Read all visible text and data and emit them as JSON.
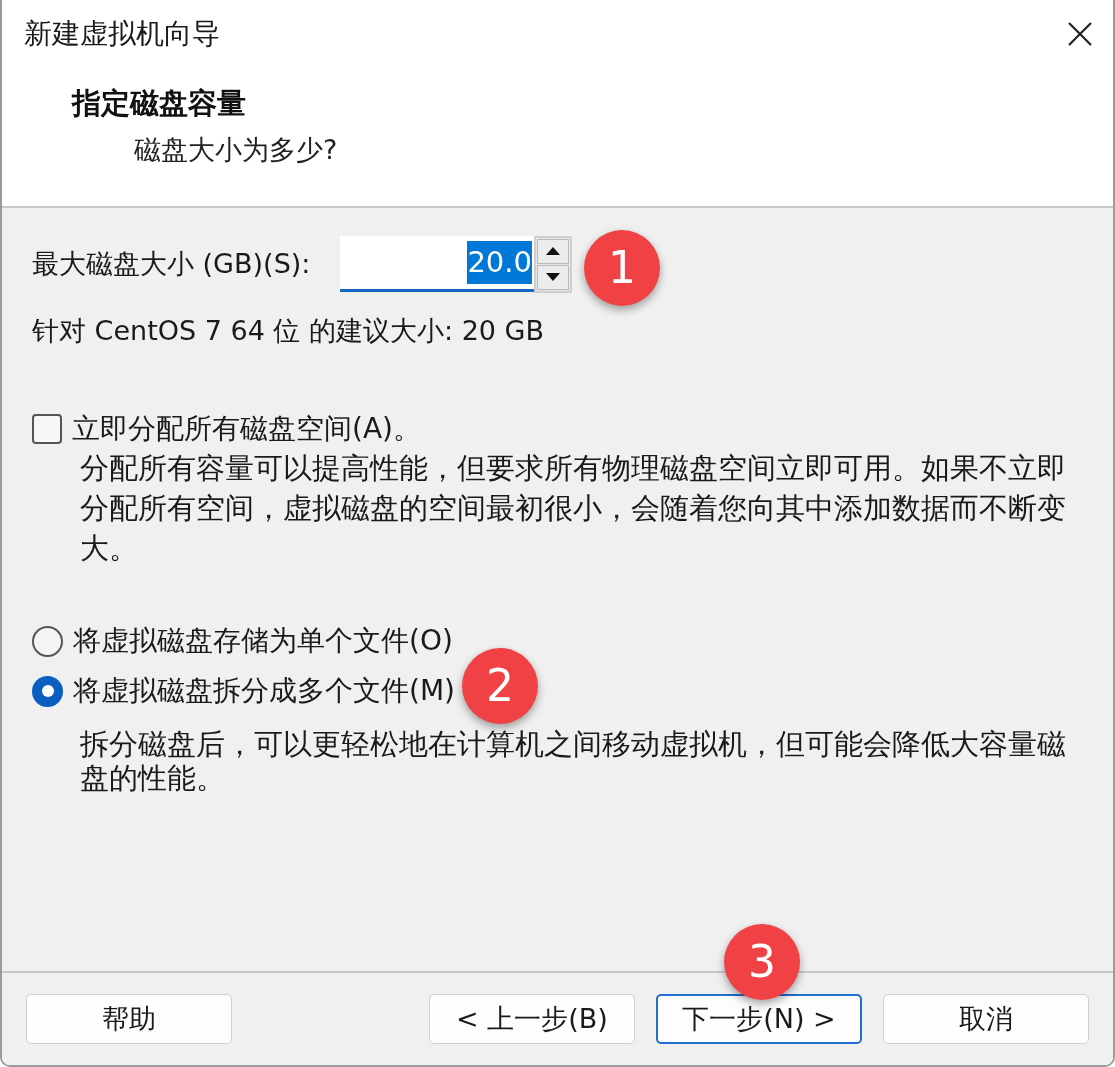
{
  "window": {
    "title": "新建虚拟机向导"
  },
  "header": {
    "title": "指定磁盘容量",
    "subtitle": "磁盘大小为多少?"
  },
  "disk_size": {
    "label": "最大磁盘大小 (GB)(S):",
    "value": "20.0",
    "selected_text": true
  },
  "recommendation": "针对 CentOS 7 64 位 的建议大小: 20 GB",
  "allocate": {
    "label": "立即分配所有磁盘空间(A)。",
    "checked": false,
    "description": "分配所有容量可以提高性能，但要求所有物理磁盘空间立即可用。如果不立即分配所有空间，虚拟磁盘的空间最初很小，会随着您向其中添加数据而不断变大。"
  },
  "storage_options": [
    {
      "label": "将虚拟磁盘存储为单个文件(O)",
      "selected": false
    },
    {
      "label": "将虚拟磁盘拆分成多个文件(M)",
      "selected": true,
      "description": "拆分磁盘后，可以更轻松地在计算机之间移动虚拟机，但可能会降低大容量磁盘的性能。"
    }
  ],
  "buttons": [
    {
      "label": "帮助",
      "kind": "left",
      "focused": false
    },
    {
      "label": "< 上一步(B)",
      "kind": "right",
      "focused": false
    },
    {
      "label": "下一步(N) >",
      "kind": "right",
      "focused": true
    },
    {
      "label": "取消",
      "kind": "right",
      "focused": false
    }
  ],
  "annotations": [
    "1",
    "2",
    "3"
  ]
}
